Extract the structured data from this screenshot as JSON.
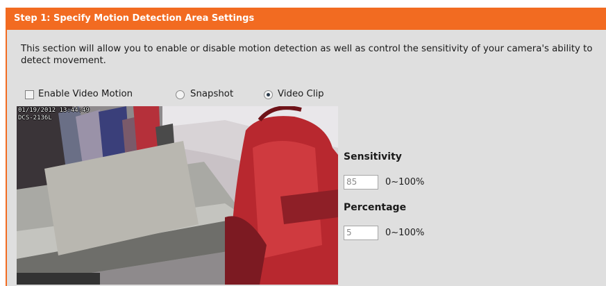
{
  "header": {
    "title": "Step 1: Specify Motion Detection Area Settings"
  },
  "description": "This section will allow you to enable or disable motion detection as well as control the sensitivity of your camera's ability to detect movement.",
  "options": {
    "enable_video_motion": {
      "label": "Enable Video Motion",
      "checked": false
    },
    "snapshot": {
      "label": "Snapshot",
      "selected": false
    },
    "video_clip": {
      "label": "Video Clip",
      "selected": true
    }
  },
  "video": {
    "timestamp": "01/19/2012 13:44:49",
    "camera_name": "DCS-2136L"
  },
  "sensitivity": {
    "label": "Sensitivity",
    "value": "85",
    "range": "0~100%"
  },
  "percentage": {
    "label": "Percentage",
    "value": "5",
    "range": "0~100%"
  },
  "colors": {
    "header_bg": "#f26b21",
    "panel_bg": "#dfdfdf"
  }
}
